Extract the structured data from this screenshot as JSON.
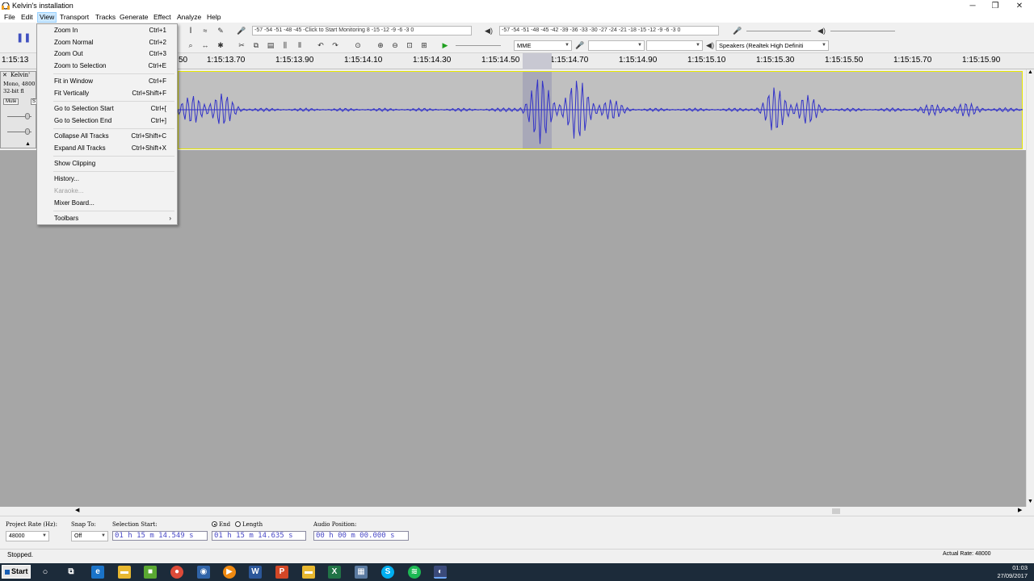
{
  "window": {
    "title": "Kelvin's installation",
    "minimize": "─",
    "maximize": "❐",
    "close": "✕"
  },
  "menubar": {
    "items": [
      "File",
      "Edit",
      "View",
      "Transport",
      "Tracks",
      "Generate",
      "Effect",
      "Analyze",
      "Help"
    ]
  },
  "toolbars": {
    "record_meter_text": "-57 -54 -51 -48 -45 -Click to Start Monitoring 8 -15 -12 -9 -6 -3 0",
    "playback_meter_text": "-57 -54 -51 -48 -45 -42 -39 -36 -33 -30 -27 -24 -21 -18 -15 -12 -9 -6 -3 0",
    "host": "MME",
    "output_device": "Speakers (Realtek High Definiti"
  },
  "ruler": {
    "ticks": [
      "1:15:13",
      "50",
      "1:15:13.70",
      "1:15:13.90",
      "1:15:14.10",
      "1:15:14.30",
      "1:15:14.50",
      "1:15:14.70",
      "1:15:14.90",
      "1:15:15.10",
      "1:15:15.30",
      "1:15:15.50",
      "1:15:15.70",
      "1:15:15.90"
    ]
  },
  "track": {
    "name": "Kelvin'",
    "info_line1": "Mono, 4800",
    "info_line2": "32-bit fl",
    "mute": "Mute",
    "solo": "S",
    "close": "✕"
  },
  "view_menu": {
    "items": [
      {
        "label": "Zoom In",
        "shortcut": "Ctrl+1",
        "enabled": true
      },
      {
        "label": "Zoom Normal",
        "shortcut": "Ctrl+2",
        "enabled": true
      },
      {
        "label": "Zoom Out",
        "shortcut": "Ctrl+3",
        "enabled": true
      },
      {
        "label": "Zoom to Selection",
        "shortcut": "Ctrl+E",
        "enabled": true
      },
      {
        "label": "Fit in Window",
        "shortcut": "Ctrl+F",
        "enabled": true
      },
      {
        "label": "Fit Vertically",
        "shortcut": "Ctrl+Shift+F",
        "enabled": true
      },
      {
        "label": "Go to Selection Start",
        "shortcut": "Ctrl+[",
        "enabled": true
      },
      {
        "label": "Go to Selection End",
        "shortcut": "Ctrl+]",
        "enabled": true
      },
      {
        "label": "Collapse All Tracks",
        "shortcut": "Ctrl+Shift+C",
        "enabled": true
      },
      {
        "label": "Expand All Tracks",
        "shortcut": "Ctrl+Shift+X",
        "enabled": true
      },
      {
        "label": "Show Clipping",
        "shortcut": "",
        "enabled": true
      },
      {
        "label": "History...",
        "shortcut": "",
        "enabled": true
      },
      {
        "label": "Karaoke...",
        "shortcut": "",
        "enabled": false
      },
      {
        "label": "Mixer Board...",
        "shortcut": "",
        "enabled": true
      },
      {
        "label": "Toolbars",
        "shortcut": "›",
        "enabled": true
      }
    ]
  },
  "selection_toolbar": {
    "project_rate_label": "Project Rate (Hz):",
    "project_rate_value": "48000",
    "snap_to_label": "Snap To:",
    "snap_to_value": "Off",
    "selection_start_label": "Selection Start:",
    "selection_start_value": "01 h 15 m 14.549 s",
    "end_label": "End",
    "length_label": "Length",
    "end_value": "01 h 15 m 14.635 s",
    "audio_position_label": "Audio Position:",
    "audio_position_value": "00 h 00 m 00.000 s"
  },
  "status": {
    "left": "Stopped.",
    "right": "Actual Rate: 48000"
  },
  "taskbar": {
    "start": "Start",
    "time": "01:03",
    "date": "27/09/2017"
  },
  "colors": {
    "waveform": "#3232c8",
    "selection": "#a8a8b8",
    "track_border": "#e8e800",
    "menu_highlight": "#cce8ff"
  }
}
